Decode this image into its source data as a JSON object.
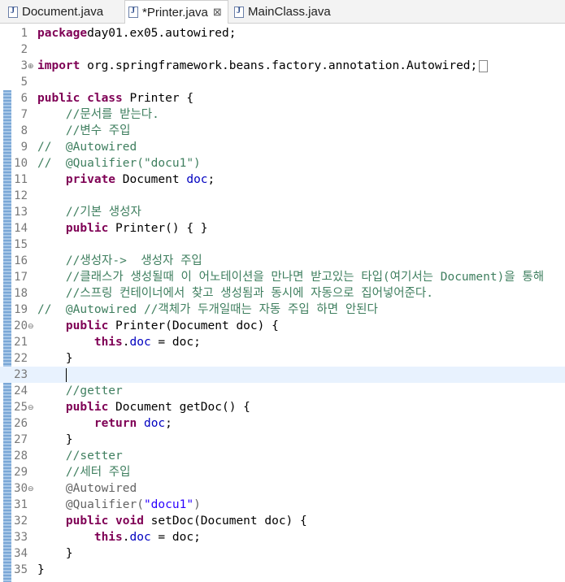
{
  "tabs": [
    {
      "label": "Document.java",
      "active": false
    },
    {
      "label": "*Printer.java",
      "active": true,
      "close": "⊠"
    },
    {
      "label": "MainClass.java",
      "active": false
    }
  ],
  "editor": {
    "current_line": 23,
    "lines": [
      {
        "n": "1",
        "t": [
          [
            "kw",
            "package"
          ],
          [
            "",
            "day01.ex05.autowired;"
          ]
        ]
      },
      {
        "n": "2",
        "t": []
      },
      {
        "n": "3",
        "fold": "⊕",
        "t": [
          [
            "kw",
            "import"
          ],
          [
            "",
            " org.springframework.beans.factory.annotation.Autowired;"
          ]
        ],
        "ellipsis": true
      },
      {
        "n": "5",
        "t": []
      },
      {
        "n": "6",
        "t": [
          [
            "kw",
            "public class"
          ],
          [
            "",
            " Printer {"
          ]
        ]
      },
      {
        "n": "7",
        "t": [
          [
            "",
            "    "
          ],
          [
            "cm",
            "//문서를 받는다."
          ]
        ]
      },
      {
        "n": "8",
        "t": [
          [
            "",
            "    "
          ],
          [
            "cm",
            "//변수 주입"
          ]
        ]
      },
      {
        "n": "9",
        "t": [
          [
            "cm",
            "//  @Autowired"
          ]
        ]
      },
      {
        "n": "10",
        "t": [
          [
            "cm",
            "//  @Qualifier(\"docu1\")"
          ]
        ]
      },
      {
        "n": "11",
        "t": [
          [
            "",
            "    "
          ],
          [
            "kw",
            "private"
          ],
          [
            "",
            " Document "
          ],
          [
            "fld",
            "doc"
          ],
          [
            "",
            ";"
          ]
        ]
      },
      {
        "n": "12",
        "t": []
      },
      {
        "n": "13",
        "t": [
          [
            "",
            "    "
          ],
          [
            "cm",
            "//기본 생성자"
          ]
        ]
      },
      {
        "n": "14",
        "t": [
          [
            "",
            "    "
          ],
          [
            "kw",
            "public"
          ],
          [
            "",
            " Printer() { }"
          ]
        ]
      },
      {
        "n": "15",
        "t": []
      },
      {
        "n": "16",
        "t": [
          [
            "",
            "    "
          ],
          [
            "cm",
            "//생성자->  생성자 주입"
          ]
        ]
      },
      {
        "n": "17",
        "t": [
          [
            "",
            "    "
          ],
          [
            "cm",
            "//클래스가 생성될때 이 어노테이션을 만나면 받고있는 타입(여기서는 Document)을 통해"
          ]
        ]
      },
      {
        "n": "18",
        "t": [
          [
            "",
            "    "
          ],
          [
            "cm",
            "//스프링 컨테이너에서 찾고 생성됨과 동시에 자동으로 집어넣어준다."
          ]
        ]
      },
      {
        "n": "19",
        "t": [
          [
            "cm",
            "//  @Autowired //객체가 두개일때는 자동 주입 하면 안된다"
          ]
        ]
      },
      {
        "n": "20",
        "fold": "⊖",
        "t": [
          [
            "",
            "    "
          ],
          [
            "kw",
            "public"
          ],
          [
            "",
            " Printer(Document doc) {"
          ]
        ]
      },
      {
        "n": "21",
        "t": [
          [
            "",
            "        "
          ],
          [
            "kw",
            "this"
          ],
          [
            "",
            "."
          ],
          [
            "fld",
            "doc"
          ],
          [
            "",
            " = doc;"
          ]
        ]
      },
      {
        "n": "22",
        "t": [
          [
            "",
            "    }"
          ]
        ]
      },
      {
        "n": "23",
        "t": [
          [
            "",
            "    "
          ]
        ],
        "caret": true
      },
      {
        "n": "24",
        "t": [
          [
            "",
            "    "
          ],
          [
            "cm",
            "//getter"
          ]
        ]
      },
      {
        "n": "25",
        "fold": "⊖",
        "t": [
          [
            "",
            "    "
          ],
          [
            "kw",
            "public"
          ],
          [
            "",
            " Document getDoc() {"
          ]
        ]
      },
      {
        "n": "26",
        "t": [
          [
            "",
            "        "
          ],
          [
            "kw",
            "return"
          ],
          [
            "",
            " "
          ],
          [
            "fld",
            "doc"
          ],
          [
            "",
            ";"
          ]
        ]
      },
      {
        "n": "27",
        "t": [
          [
            "",
            "    }"
          ]
        ]
      },
      {
        "n": "28",
        "t": [
          [
            "",
            "    "
          ],
          [
            "cm",
            "//setter"
          ]
        ]
      },
      {
        "n": "29",
        "t": [
          [
            "",
            "    "
          ],
          [
            "cm",
            "//세터 주입"
          ]
        ]
      },
      {
        "n": "30",
        "fold": "⊖",
        "t": [
          [
            "",
            "    "
          ],
          [
            "an",
            "@Autowired"
          ]
        ]
      },
      {
        "n": "31",
        "t": [
          [
            "",
            "    "
          ],
          [
            "an",
            "@Qualifier("
          ],
          [
            "st",
            "\"docu1\""
          ],
          [
            "an",
            ")"
          ]
        ]
      },
      {
        "n": "32",
        "t": [
          [
            "",
            "    "
          ],
          [
            "kw",
            "public void"
          ],
          [
            "",
            " setDoc(Document doc) {"
          ]
        ]
      },
      {
        "n": "33",
        "t": [
          [
            "",
            "        "
          ],
          [
            "kw",
            "this"
          ],
          [
            "",
            "."
          ],
          [
            "fld",
            "doc"
          ],
          [
            "",
            " = doc;"
          ]
        ]
      },
      {
        "n": "34",
        "t": [
          [
            "",
            "    }"
          ]
        ]
      },
      {
        "n": "35",
        "t": [
          [
            "",
            "}"
          ]
        ]
      }
    ]
  }
}
